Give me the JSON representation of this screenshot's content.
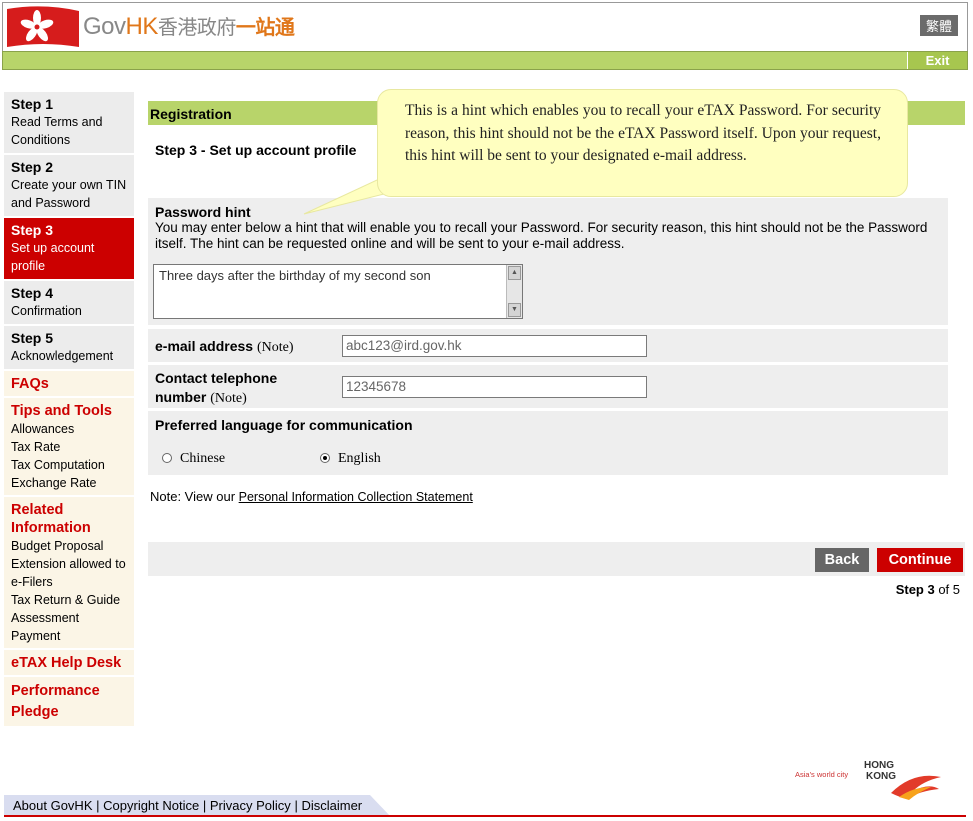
{
  "header": {
    "logo_gov": "Gov",
    "logo_hk": "HK",
    "logo_cn": "香港政府",
    "logo_cn2": "一站通",
    "lang_toggle": "繁體",
    "exit": "Exit"
  },
  "sidebar": {
    "steps": [
      {
        "title": "Step 1",
        "desc": "Read Terms and Conditions"
      },
      {
        "title": "Step 2",
        "desc": "Create your own TIN and Password"
      },
      {
        "title": "Step 3",
        "desc": "Set up account profile"
      },
      {
        "title": "Step 4",
        "desc": "Confirmation"
      },
      {
        "title": "Step 5",
        "desc": "Acknowledgement"
      }
    ],
    "faqs": "FAQs",
    "tips": {
      "heading": "Tips and Tools",
      "links": [
        "Allowances",
        "Tax Rate",
        "Tax Computation",
        "Exchange Rate"
      ]
    },
    "related": {
      "heading": "Related Information",
      "links": [
        "Budget Proposal",
        "Extension allowed to e-Filers",
        "Tax Return & Guide",
        "Assessment",
        "Payment"
      ]
    },
    "helpdesk": "eTAX Help Desk",
    "pledge": "Performance Pledge"
  },
  "main": {
    "section_title": "Registration",
    "step_title": "Step 3 - Set up account profile",
    "password_hint": {
      "label": "Password hint",
      "description": "You may enter below a hint that will enable you to recall your Password. For security reason, this hint should not be the Password itself. The hint can be requested online and will be sent to your e-mail address.",
      "value": "Three days after the birthday of my second son"
    },
    "email": {
      "label": "e-mail address",
      "note": "(Note)",
      "value": "abc123@ird.gov.hk"
    },
    "phone": {
      "label1": "Contact telephone",
      "label2": "number",
      "note": "(Note)",
      "value": "12345678"
    },
    "language": {
      "label": "Preferred language for communication",
      "options": [
        "Chinese",
        "English"
      ],
      "selected": "English"
    },
    "note_prefix": "Note: View our ",
    "note_link": "Personal Information Collection Statement",
    "back": "Back",
    "continue": "Continue",
    "step_bold": "Step 3",
    "step_rest": " of 5"
  },
  "tooltip": "This is a hint which enables you to recall your eTAX Password. For security reason, this hint should not be the eTAX Password itself.  Upon your request, this hint will be sent to your designated e-mail address.",
  "brand": {
    "tagline": "Asia's world city",
    "line1": "HONG",
    "line2": "KONG"
  },
  "footer": {
    "links": [
      "About GovHK",
      "Copyright Notice",
      "Privacy Policy",
      "Disclaimer"
    ]
  },
  "colors": {
    "accent_red": "#cc0000",
    "green_bar": "#b8d46a",
    "tooltip_bg": "#ffffc0"
  }
}
